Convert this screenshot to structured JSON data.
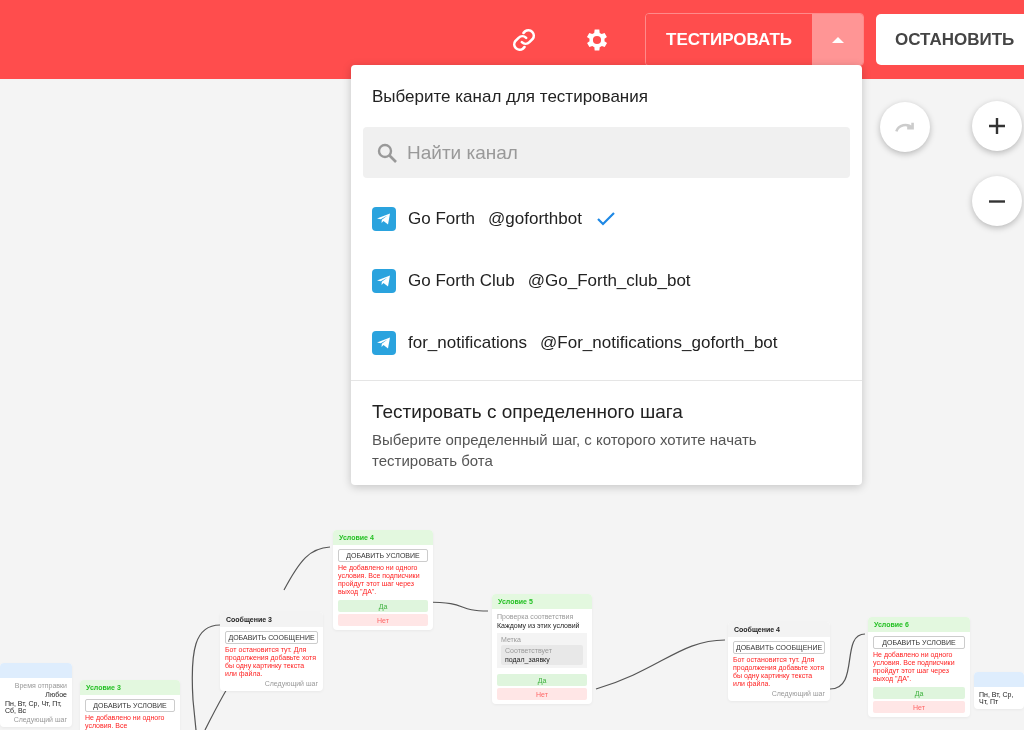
{
  "toolbar": {
    "test_button": "ТЕСТИРОВАТЬ",
    "test_menu_open": true,
    "stop_button": "ОСТАНОВИТЬ"
  },
  "test_menu": {
    "title": "Выберите канал для тестирования",
    "search": {
      "placeholder": "Найти канал"
    },
    "channels": [
      {
        "name": "Go Forth",
        "handle": "@goforthbot",
        "selected": true
      },
      {
        "name": "Go Forth Club",
        "handle": "@Go_Forth_club_bot",
        "selected": false
      },
      {
        "name": "for_notifications",
        "handle": "@For_notifications_goforth_bot",
        "selected": false
      }
    ],
    "from_step": {
      "title": "Тестировать с определенного шага",
      "description": "Выберите определенный шаг, с которого хотите начать тестировать бота"
    }
  },
  "canvas": {
    "redo_disabled": true,
    "nodes": [
      {
        "kind": "delay",
        "send_time_label": "Время отправки",
        "send_time": "Любое",
        "days": "Пн, Вт, Ср, Чт, Пт, Сб, Вс",
        "next_label": "Следующий шаг"
      },
      {
        "kind": "condition",
        "title": "Условие 3",
        "add_button": "ДОБАВИТЬ УСЛОВИЕ",
        "warning": "Не добавлено ни одного условия. Все"
      },
      {
        "kind": "message",
        "title": "Сообщение 3",
        "add_button": "ДОБАВИТЬ СООБЩЕНИЕ",
        "warning": "Бот остановится тут. Для продолжения добавьте хотя бы одну картинку текста или файла.",
        "next_label": "Следующий шаг"
      },
      {
        "kind": "condition",
        "title": "Условие 4",
        "add_button": "ДОБАВИТЬ УСЛОВИЕ",
        "warning": "Не добавлено ни одного условия. Все подписчики пройдут этот шаг через выход \"ДА\".",
        "yes": "Да",
        "no": "Нет"
      },
      {
        "kind": "condition",
        "title": "Условие 5",
        "match_label": "Проверка соответствия",
        "match_value": "Каждому из этих условий",
        "rule_label": "Метка",
        "rule_op": "Соответствует",
        "rule_value": "подал_заявку",
        "yes": "Да",
        "no": "Нет"
      },
      {
        "kind": "message",
        "title": "Сообщение 4",
        "add_button": "ДОБАВИТЬ СООБЩЕНИЕ",
        "warning": "Бот остановится тут. Для продолжения добавьте хотя бы одну картинку текста или файла.",
        "next_label": "Следующий шаг"
      },
      {
        "kind": "condition",
        "title": "Условие 6",
        "add_button": "ДОБАВИТЬ УСЛОВИЕ",
        "warning": "Не добавлено ни одного условия. Все подписчики пройдут этот шаг через выход \"ДА\".",
        "yes": "Да",
        "no": "Нет"
      },
      {
        "kind": "delay",
        "days": "Пн, Вт, Ср, Чт, Пт"
      }
    ]
  }
}
